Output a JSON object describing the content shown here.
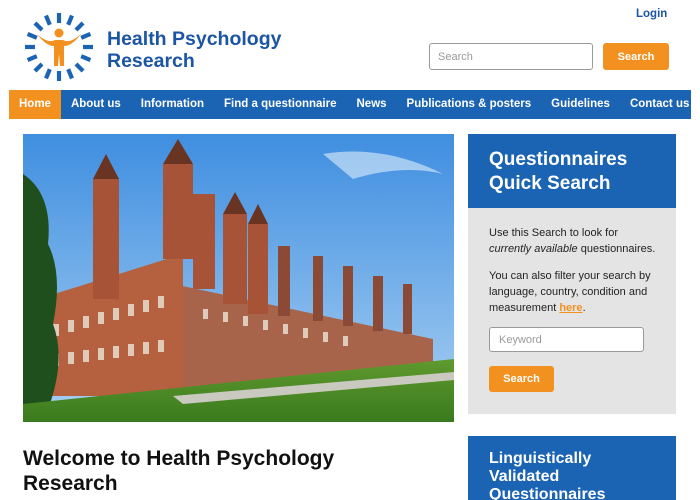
{
  "header": {
    "login_label": "Login",
    "brand_line1": "Health Psychology",
    "brand_line2": "Research",
    "search_placeholder": "Search",
    "search_button_label": "Search"
  },
  "nav": {
    "items": [
      {
        "label": "Home",
        "active": true
      },
      {
        "label": "About us"
      },
      {
        "label": "Information"
      },
      {
        "label": "Find a questionnaire"
      },
      {
        "label": "News"
      },
      {
        "label": "Publications & posters"
      },
      {
        "label": "Guidelines"
      },
      {
        "label": "Contact us"
      }
    ]
  },
  "quick_search": {
    "title_line1": "Questionnaires",
    "title_line2": "Quick Search",
    "text1_a": "Use this Search to look for",
    "text1_em": "currently available",
    "text1_b": " questionnaires.",
    "text2": "You can also filter your search by language, country, condition and measurement ",
    "link_label": "here",
    "text2_end": ".",
    "keyword_placeholder": "Keyword",
    "button_label": "Search"
  },
  "main": {
    "welcome_line1": "Welcome to Health Psychology",
    "welcome_line2": "Research"
  },
  "linguistic": {
    "title_line1": "Linguistically",
    "title_line2": "Validated",
    "title_line3": "Questionnaires"
  },
  "colors": {
    "brand_blue": "#1b63b3",
    "accent_orange": "#f39120"
  }
}
